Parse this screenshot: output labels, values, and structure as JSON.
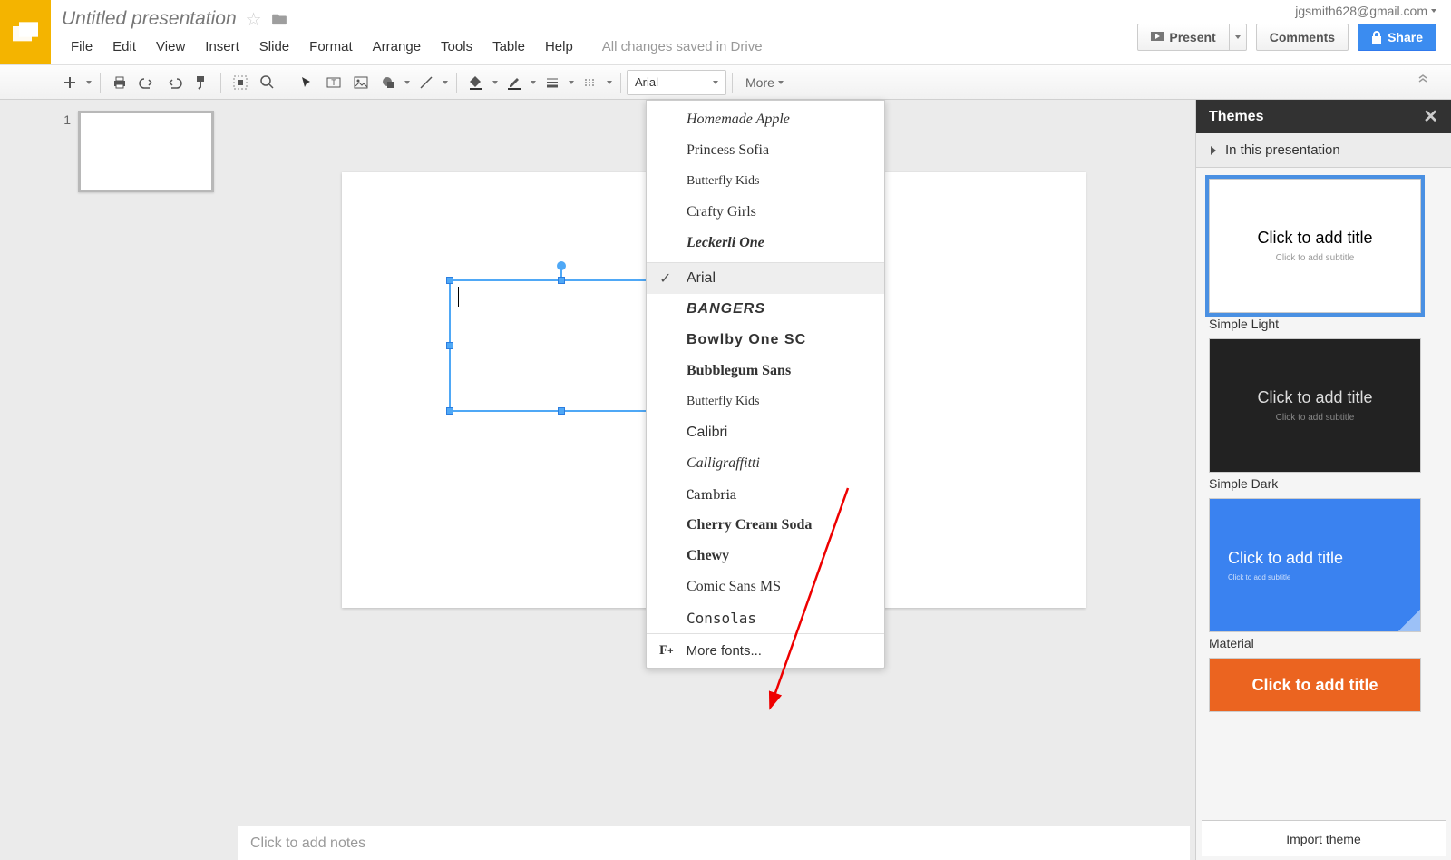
{
  "header": {
    "doc_title": "Untitled presentation",
    "user_email": "jgsmith628@gmail.com",
    "menus": [
      "File",
      "Edit",
      "View",
      "Insert",
      "Slide",
      "Format",
      "Arrange",
      "Tools",
      "Table",
      "Help"
    ],
    "saved_status": "All changes saved in Drive",
    "present_label": "Present",
    "comments_label": "Comments",
    "share_label": "Share"
  },
  "toolbar": {
    "font_selected": "Arial",
    "more_label": "More"
  },
  "filmstrip": {
    "slides": [
      {
        "number": "1"
      }
    ]
  },
  "notes_placeholder": "Click to add notes",
  "font_dropdown": {
    "recent": [
      "Homemade Apple",
      "Princess Sofia",
      "Butterfly Kids",
      "Crafty Girls",
      "Leckerli One"
    ],
    "fonts": [
      "Arial",
      "BANGERS",
      "Bowlby One SC",
      "Bubblegum Sans",
      "Butterfly Kids",
      "Calibri",
      "Calligraffitti",
      "Cambria",
      "Cherry Cream Soda",
      "Chewy",
      "Comic Sans MS",
      "Consolas"
    ],
    "selected": "Arial",
    "more_fonts": "More fonts..."
  },
  "themes_panel": {
    "title": "Themes",
    "in_this": "In this presentation",
    "import": "Import theme",
    "themes": [
      {
        "name": "Simple Light",
        "title": "Click to add title",
        "sub": "Click to add subtitle"
      },
      {
        "name": "Simple Dark",
        "title": "Click to add title",
        "sub": "Click to add subtitle"
      },
      {
        "name": "Material",
        "title": "Click to add title",
        "sub": "Click to add subtitle"
      },
      {
        "name": "",
        "title": "Click to add title",
        "sub": ""
      }
    ]
  }
}
